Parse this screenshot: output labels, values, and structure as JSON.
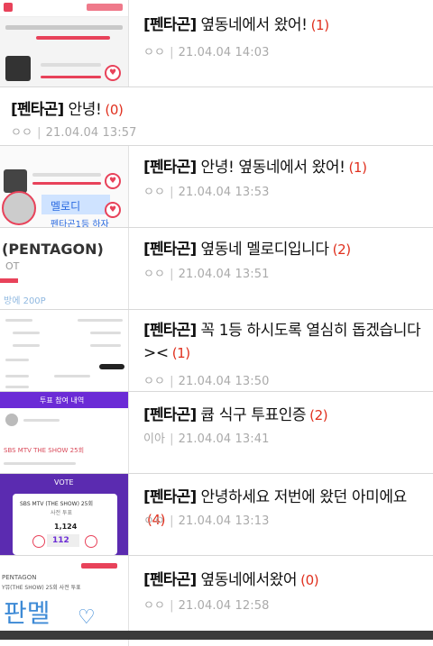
{
  "feed": {
    "posts": [
      {
        "prefix": "[펜타곤]",
        "title": "옆동네에서 왔어!",
        "count": "(1)",
        "author": "ㅇㅇ",
        "date": "21.04.04 14:03",
        "has_thumb": true
      },
      {
        "prefix": "[펜타곤]",
        "title": "안녕!",
        "count": "(0)",
        "author": "ㅇㅇ",
        "date": "21.04.04 13:57",
        "has_thumb": false
      },
      {
        "prefix": "[펜타곤]",
        "title": "안녕! 옆동네에서 왔어!",
        "count": "(1)",
        "author": "ㅇㅇ",
        "date": "21.04.04 13:53",
        "has_thumb": true
      },
      {
        "prefix": "[펜타곤]",
        "title": "옆동네 멜로디입니다",
        "count": "(2)",
        "author": "ㅇㅇ",
        "date": "21.04.04 13:51",
        "has_thumb": true
      },
      {
        "prefix": "[펜타곤]",
        "title": "꼭 1등 하시도록 열심히 돕겠습니다><",
        "count": "(1)",
        "author": "ㅇㅇ",
        "date": "21.04.04 13:50",
        "has_thumb": true
      },
      {
        "prefix": "[펜타곤]",
        "title": "큡 식구 투표인증",
        "count": "(2)",
        "author": "이아",
        "date": "21.04.04 13:41",
        "has_thumb": true
      },
      {
        "prefix": "[펜타곤]",
        "title": "안녕하세요 저번에 왔던 아미에요",
        "count": "(4)",
        "author": "ㅇㅇ",
        "date": "21.04.04 13:13",
        "has_thumb": true
      },
      {
        "prefix": "[펜타곤]",
        "title": "옆동네에서왔어",
        "count": "(0)",
        "author": "ㅇㅇ",
        "date": "21.04.04 12:58",
        "has_thumb": true
      }
    ]
  },
  "thumbnails": {
    "t3": {
      "sticker_text": "멜로디",
      "sticker_text2": "펜타곤1등 하자"
    },
    "t4": {
      "group_name": "(PENTAGON)",
      "sub": "OT",
      "points": "방에 200P"
    },
    "t6": {
      "header": "투표 참여 내역",
      "item": "SBS MTV THE SHOW 25회"
    },
    "t7": {
      "vote_label": "VOTE",
      "show": "SBS MTV (THE SHOW) 25회",
      "sub": "사전 투표",
      "total": "1,124",
      "picked": "112"
    },
    "t8": {
      "group": "PENTAGON",
      "show": "Y뮤(THE SHOW) 25회 사전 투표",
      "hand": "판멜"
    }
  },
  "colors": {
    "accent": "#e0301e",
    "meta": "#aaaaaa",
    "title": "#111111"
  }
}
